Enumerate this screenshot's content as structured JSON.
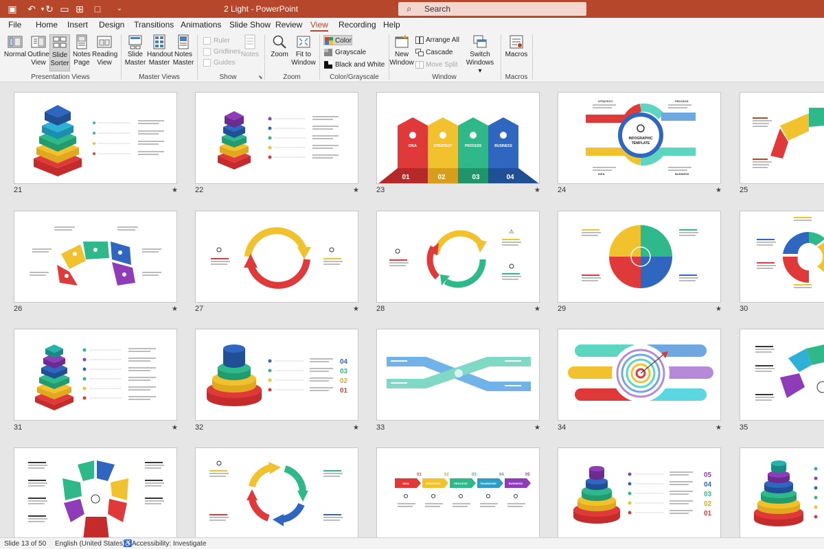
{
  "title_bar": {
    "document_title": "2 Light  -  PowerPoint",
    "search_placeholder": "Search",
    "accent_color": "#b7472a"
  },
  "menu": {
    "tabs": [
      "File",
      "Home",
      "Insert",
      "Design",
      "Transitions",
      "Animations",
      "Slide Show",
      "Review",
      "View",
      "Recording",
      "Help"
    ],
    "active_tab": "View"
  },
  "ribbon": {
    "presentation_views": {
      "label": "Presentation Views",
      "normal": "Normal",
      "outline_view_1": "Outline",
      "outline_view_2": "View",
      "slide_sorter_1": "Slide",
      "slide_sorter_2": "Sorter",
      "notes_page_1": "Notes",
      "notes_page_2": "Page",
      "reading_view_1": "Reading",
      "reading_view_2": "View"
    },
    "master_views": {
      "label": "Master Views",
      "slide_master_1": "Slide",
      "slide_master_2": "Master",
      "handout_master_1": "Handout",
      "handout_master_2": "Master",
      "notes_master_1": "Notes",
      "notes_master_2": "Master"
    },
    "show": {
      "label": "Show",
      "ruler": "Ruler",
      "gridlines": "Gridlines",
      "guides": "Guides",
      "notes": "Notes"
    },
    "zoom": {
      "label": "Zoom",
      "zoom": "Zoom",
      "fit_1": "Fit to",
      "fit_2": "Window"
    },
    "color_grayscale": {
      "label": "Color/Grayscale",
      "color": "Color",
      "grayscale": "Grayscale",
      "black_white": "Black and White"
    },
    "window": {
      "label": "Window",
      "new_window_1": "New",
      "new_window_2": "Window",
      "arrange_all": "Arrange All",
      "cascade": "Cascade",
      "move_split": "Move Split",
      "switch_1": "Switch",
      "switch_2": "Windows ▾"
    },
    "macros": {
      "label": "Macros",
      "macros": "Macros"
    }
  },
  "slides": {
    "visible_numbers": [
      "21",
      "22",
      "23",
      "24",
      "25",
      "26",
      "27",
      "28",
      "29",
      "30",
      "31",
      "32",
      "33",
      "34",
      "35"
    ],
    "star_symbol": "★",
    "s23_numbers": [
      "01",
      "02",
      "03",
      "04"
    ],
    "s23_labels": [
      "IDEA",
      "STRATEGY",
      "PROCESS",
      "BUSINESS"
    ],
    "s24_title": "INFOGRAPHIC\nTEMPLATE",
    "s24_labels": [
      "STRATEGY",
      "PROCESS",
      "IDEA",
      "BUSINESS"
    ],
    "s32_numbers": [
      "04",
      "03",
      "02",
      "01"
    ],
    "s39_numbers": [
      "05",
      "04",
      "03",
      "02",
      "01"
    ],
    "s38_labels": [
      "IDEA",
      "STRATEGY",
      "PROCESS",
      "TEAMWORK",
      "BUSINESS"
    ],
    "s38_numbers": [
      "01",
      "02",
      "03",
      "04",
      "05"
    ]
  },
  "status_bar": {
    "slide_info": "Slide 13 of 50",
    "language": "English (United States)",
    "accessibility": "Accessibility: Investigate"
  }
}
